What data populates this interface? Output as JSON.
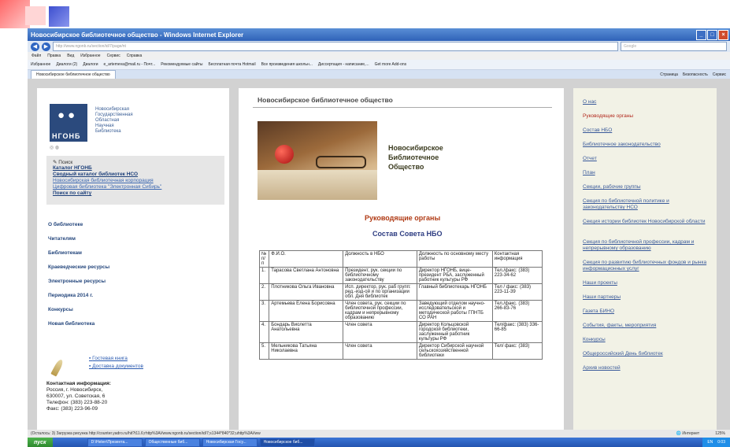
{
  "window": {
    "title": "Новосибирское библиотечное общество - Windows Internet Explorer",
    "url": "http://www.ngonb.ru/section/id/7/page/nt",
    "search_placeholder": "Google"
  },
  "menu": [
    "Файл",
    "Правка",
    "Вид",
    "Избранное",
    "Сервис",
    "Справка"
  ],
  "favorites": [
    "Избранное",
    "Диалоги (2)",
    "Диалоги",
    "e_artemeva@mail.ru - Почт...",
    "Рекомендуемые сайты",
    "Бесплатная почта Hotmail",
    "Все произведения школьн...",
    "Диссертация - написание,...",
    "Get more Add-ons"
  ],
  "tab": {
    "label": "Новосибирское библиотечное общество",
    "tools": [
      "Страница",
      "Безопасность",
      "Сервис"
    ]
  },
  "left": {
    "logo_text": "НГОНБ",
    "logo_caption": [
      "Новосибирская",
      "Государственная",
      "Областная",
      "Научная",
      "Библиотека"
    ],
    "search": {
      "label": "Поиск",
      "bold_links": [
        "Каталог НГОНБ",
        "Сводный каталог библиотек НСО"
      ],
      "links": [
        "Новосибирская библиотечная корпорация",
        "Цифровая библиотека \"Электронная Сибирь\""
      ],
      "last": "Поиск по сайту"
    },
    "nav": [
      "О библиотеке",
      "Читателям",
      "Библиотекам",
      "Краеведческие ресурсы",
      "Электронные ресурсы",
      "Периодика 2014 г.",
      "Конкурсы",
      "Новая библиотека"
    ],
    "bottom_links": [
      "Гостевая книга",
      "Доставка документов"
    ],
    "contact": {
      "title": "Контактная информация:",
      "lines": [
        "Россия, г. Новосибирск,",
        "630007, ул. Советская, 6",
        "Телефон: (383) 223-88-20",
        "Факс: (383) 223-96-09"
      ]
    }
  },
  "main": {
    "site_title": "Новосибирское библиотечное общество",
    "picture_title": [
      "Новосибирское",
      "Библиотечное",
      "Общество"
    ],
    "heading1": "Руководящие органы",
    "heading2": "Состав Совета НБО",
    "table": {
      "headers": [
        "№ п/п",
        "Ф.И.О.",
        "Должность в НБО",
        "Должность по основному месту работы",
        "Контактная информация"
      ],
      "rows": [
        [
          "1.",
          "Тарасова Светлана Антоновна",
          "Президент, рук. секции по библиотечному законодательству",
          "Директор НГОНБ, вице-президент РБА, заслуженный работник культуры РФ",
          "Тел./факс: (383) 223-34-62"
        ],
        [
          "2.",
          "Плотникова Ольга Ивановна",
          "Исп. директор, рук. раб групп: ред.-изд-ой и по организации обл. Дня библиотек",
          "Главный библиотекарь НГОНБ",
          "Тел / факс: (383) 223-11-39"
        ],
        [
          "3.",
          "Артемьева Елена Борисовна",
          "Член совета, рук. секции по библиотечной профессии, кадрам и непрерывному образованию",
          "Заведующий отделом научно-исследовательской и методической работы ГПНТБ СО РАН",
          "Тел./факс. (383) 266-83-76"
        ],
        [
          "4.",
          "Бондарь Виолетта Анатольевна",
          "Член совета",
          "Директор Кольцовской городской библиотеки, заслуженный работник культуры РФ",
          "Тел/факс: (383) 336-66-85"
        ],
        [
          "5.",
          "Мельникова Татьяна Николаевна",
          "Член совета",
          "Директор Сибирской научной сельскохозяйственной библиотеки",
          "Тел/ факс: (383)"
        ]
      ]
    }
  },
  "right": {
    "links": [
      "О нас",
      "Руководящие органы",
      "Состав НБО",
      "Библиотечное законодательство",
      "Отчет",
      "План",
      "Секции, рабочие группы",
      "Секция по библиотечной политике и законодательству НСО",
      "Секция истории библиотек Новосибирской области",
      "Секция по библиотечной профессии, кадрам и непрерывному образованию",
      "Секция по развитию библиотечных фондов и рынка информационных услуг",
      "Наши проекты",
      "Наши партнеры",
      "Газета БИНО",
      "События, факты, мероприятия",
      "Конкурсы",
      "Общероссийский День библиотек",
      "Архив новостей"
    ]
  },
  "status": {
    "text": "(Осталось: 3) Загрузка рисунка http://counter.yadro.ru/hit?t11.6;rhttp%3A//www.ngonb.ru/section/id/7;s1344*840*32;uhttp%3A//ww",
    "zone": "Интернет",
    "zoom": "125%"
  },
  "taskbar": {
    "start": "пуск",
    "tasks": [
      "D:\\Helen\\Презента...",
      "Общественные биб...",
      "Новосибирская Госу...",
      "Новосибирское биб..."
    ],
    "lang": "EN",
    "clock": "0:03"
  }
}
